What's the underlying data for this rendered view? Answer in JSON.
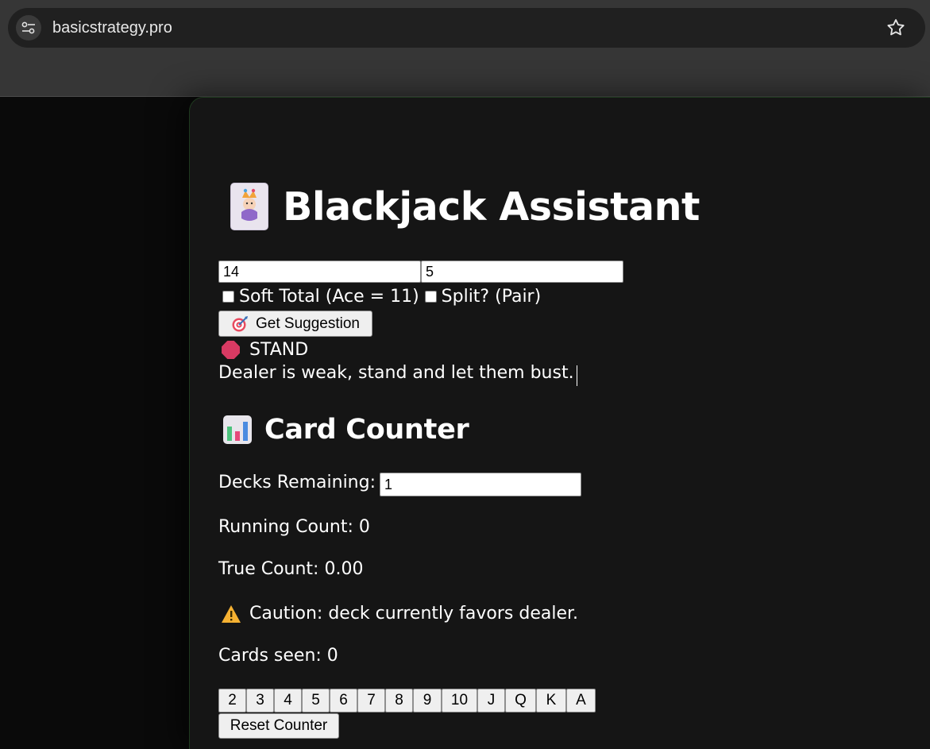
{
  "browser": {
    "url": "basicstrategy.pro"
  },
  "app": {
    "title": "Blackjack Assistant"
  },
  "suggestion": {
    "player_total_value": "14",
    "dealer_card_value": "5",
    "soft_total_label": "Soft Total (Ace = 11)",
    "split_label": "Split? (Pair)",
    "get_suggestion_label": "Get Suggestion",
    "result_action": "STAND",
    "result_explanation": "Dealer is weak, stand and let them bust."
  },
  "counter": {
    "heading": "Card Counter",
    "decks_label": "Decks Remaining:",
    "decks_value": "1",
    "running_count": "Running Count: 0",
    "true_count": "True Count: 0.00",
    "caution": "Caution: deck currently favors dealer.",
    "cards_seen": "Cards seen: 0",
    "card_buttons": [
      "2",
      "3",
      "4",
      "5",
      "6",
      "7",
      "8",
      "9",
      "10",
      "J",
      "Q",
      "K",
      "A"
    ],
    "reset_label": "Reset Counter"
  },
  "icons": {
    "site_info": "site-settings-icon",
    "bookmark": "star-icon",
    "title": "joker-card-icon",
    "suggest": "target-icon",
    "result": "stop-sign-icon",
    "counter": "bar-chart-icon",
    "caution": "warning-icon"
  }
}
